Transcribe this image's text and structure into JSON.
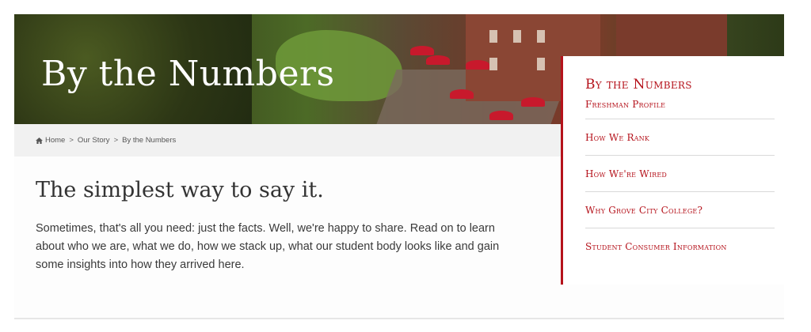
{
  "hero": {
    "title": "By the Numbers"
  },
  "breadcrumb": {
    "items": [
      {
        "label": "Home",
        "icon": "home-icon"
      },
      {
        "label": "Our Story"
      },
      {
        "label": "By the Numbers"
      }
    ],
    "separator": ">"
  },
  "main": {
    "heading": "The simplest way to say it.",
    "intro": "Sometimes, that's all you need: just the facts. Well, we're happy to share. Read on to learn about who we are, what we do, how we stack up, what our student body looks like and gain some insights into how they arrived here."
  },
  "sidebar": {
    "title": "By the Numbers",
    "items": [
      {
        "label": "Freshman Profile"
      },
      {
        "label": "How We Rank"
      },
      {
        "label": "How We're Wired"
      },
      {
        "label": "Why Grove City College?"
      },
      {
        "label": "Student Consumer Information"
      }
    ]
  },
  "colors": {
    "accent": "#b5121b",
    "breadcrumb_bg": "#f1f1f1",
    "text": "#3a3a3a"
  }
}
